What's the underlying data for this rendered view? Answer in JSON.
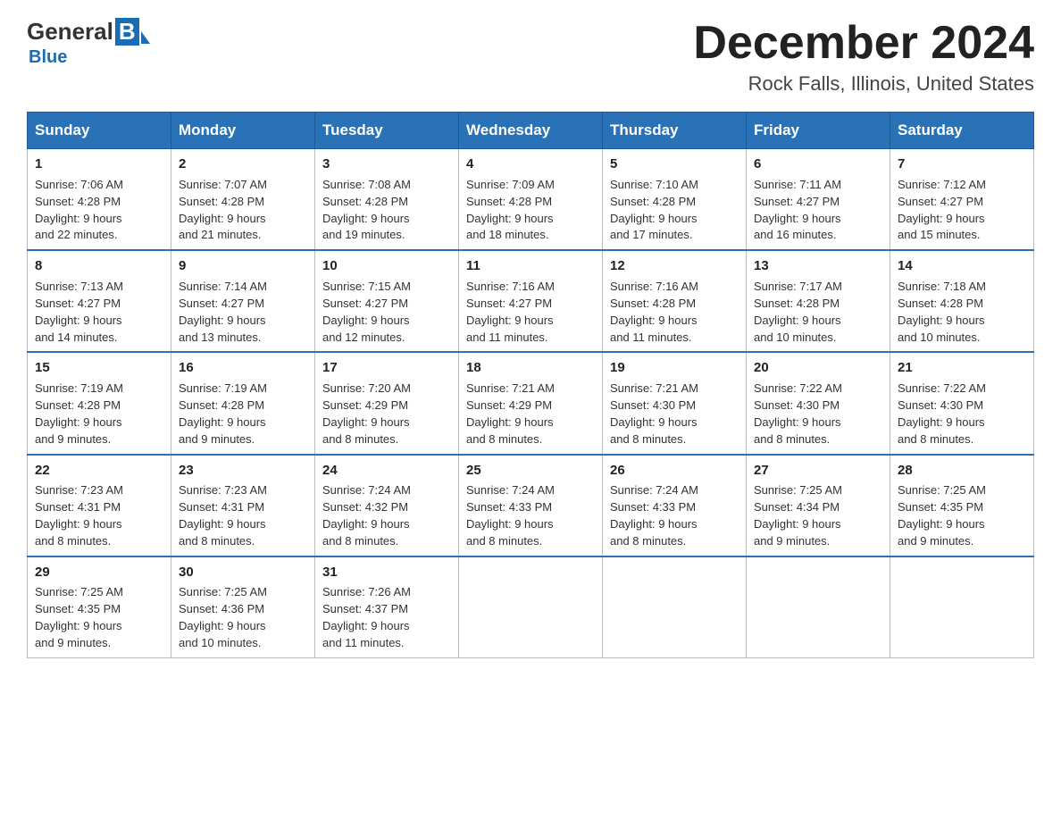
{
  "logo": {
    "general": "General",
    "blue": "Blue"
  },
  "header": {
    "title": "December 2024",
    "subtitle": "Rock Falls, Illinois, United States"
  },
  "days_of_week": [
    "Sunday",
    "Monday",
    "Tuesday",
    "Wednesday",
    "Thursday",
    "Friday",
    "Saturday"
  ],
  "weeks": [
    [
      {
        "day": "1",
        "sunrise": "7:06 AM",
        "sunset": "4:28 PM",
        "daylight": "9 hours and 22 minutes."
      },
      {
        "day": "2",
        "sunrise": "7:07 AM",
        "sunset": "4:28 PM",
        "daylight": "9 hours and 21 minutes."
      },
      {
        "day": "3",
        "sunrise": "7:08 AM",
        "sunset": "4:28 PM",
        "daylight": "9 hours and 19 minutes."
      },
      {
        "day": "4",
        "sunrise": "7:09 AM",
        "sunset": "4:28 PM",
        "daylight": "9 hours and 18 minutes."
      },
      {
        "day": "5",
        "sunrise": "7:10 AM",
        "sunset": "4:28 PM",
        "daylight": "9 hours and 17 minutes."
      },
      {
        "day": "6",
        "sunrise": "7:11 AM",
        "sunset": "4:27 PM",
        "daylight": "9 hours and 16 minutes."
      },
      {
        "day": "7",
        "sunrise": "7:12 AM",
        "sunset": "4:27 PM",
        "daylight": "9 hours and 15 minutes."
      }
    ],
    [
      {
        "day": "8",
        "sunrise": "7:13 AM",
        "sunset": "4:27 PM",
        "daylight": "9 hours and 14 minutes."
      },
      {
        "day": "9",
        "sunrise": "7:14 AM",
        "sunset": "4:27 PM",
        "daylight": "9 hours and 13 minutes."
      },
      {
        "day": "10",
        "sunrise": "7:15 AM",
        "sunset": "4:27 PM",
        "daylight": "9 hours and 12 minutes."
      },
      {
        "day": "11",
        "sunrise": "7:16 AM",
        "sunset": "4:27 PM",
        "daylight": "9 hours and 11 minutes."
      },
      {
        "day": "12",
        "sunrise": "7:16 AM",
        "sunset": "4:28 PM",
        "daylight": "9 hours and 11 minutes."
      },
      {
        "day": "13",
        "sunrise": "7:17 AM",
        "sunset": "4:28 PM",
        "daylight": "9 hours and 10 minutes."
      },
      {
        "day": "14",
        "sunrise": "7:18 AM",
        "sunset": "4:28 PM",
        "daylight": "9 hours and 10 minutes."
      }
    ],
    [
      {
        "day": "15",
        "sunrise": "7:19 AM",
        "sunset": "4:28 PM",
        "daylight": "9 hours and 9 minutes."
      },
      {
        "day": "16",
        "sunrise": "7:19 AM",
        "sunset": "4:28 PM",
        "daylight": "9 hours and 9 minutes."
      },
      {
        "day": "17",
        "sunrise": "7:20 AM",
        "sunset": "4:29 PM",
        "daylight": "9 hours and 8 minutes."
      },
      {
        "day": "18",
        "sunrise": "7:21 AM",
        "sunset": "4:29 PM",
        "daylight": "9 hours and 8 minutes."
      },
      {
        "day": "19",
        "sunrise": "7:21 AM",
        "sunset": "4:30 PM",
        "daylight": "9 hours and 8 minutes."
      },
      {
        "day": "20",
        "sunrise": "7:22 AM",
        "sunset": "4:30 PM",
        "daylight": "9 hours and 8 minutes."
      },
      {
        "day": "21",
        "sunrise": "7:22 AM",
        "sunset": "4:30 PM",
        "daylight": "9 hours and 8 minutes."
      }
    ],
    [
      {
        "day": "22",
        "sunrise": "7:23 AM",
        "sunset": "4:31 PM",
        "daylight": "9 hours and 8 minutes."
      },
      {
        "day": "23",
        "sunrise": "7:23 AM",
        "sunset": "4:31 PM",
        "daylight": "9 hours and 8 minutes."
      },
      {
        "day": "24",
        "sunrise": "7:24 AM",
        "sunset": "4:32 PM",
        "daylight": "9 hours and 8 minutes."
      },
      {
        "day": "25",
        "sunrise": "7:24 AM",
        "sunset": "4:33 PM",
        "daylight": "9 hours and 8 minutes."
      },
      {
        "day": "26",
        "sunrise": "7:24 AM",
        "sunset": "4:33 PM",
        "daylight": "9 hours and 8 minutes."
      },
      {
        "day": "27",
        "sunrise": "7:25 AM",
        "sunset": "4:34 PM",
        "daylight": "9 hours and 9 minutes."
      },
      {
        "day": "28",
        "sunrise": "7:25 AM",
        "sunset": "4:35 PM",
        "daylight": "9 hours and 9 minutes."
      }
    ],
    [
      {
        "day": "29",
        "sunrise": "7:25 AM",
        "sunset": "4:35 PM",
        "daylight": "9 hours and 9 minutes."
      },
      {
        "day": "30",
        "sunrise": "7:25 AM",
        "sunset": "4:36 PM",
        "daylight": "9 hours and 10 minutes."
      },
      {
        "day": "31",
        "sunrise": "7:26 AM",
        "sunset": "4:37 PM",
        "daylight": "9 hours and 11 minutes."
      },
      null,
      null,
      null,
      null
    ]
  ]
}
